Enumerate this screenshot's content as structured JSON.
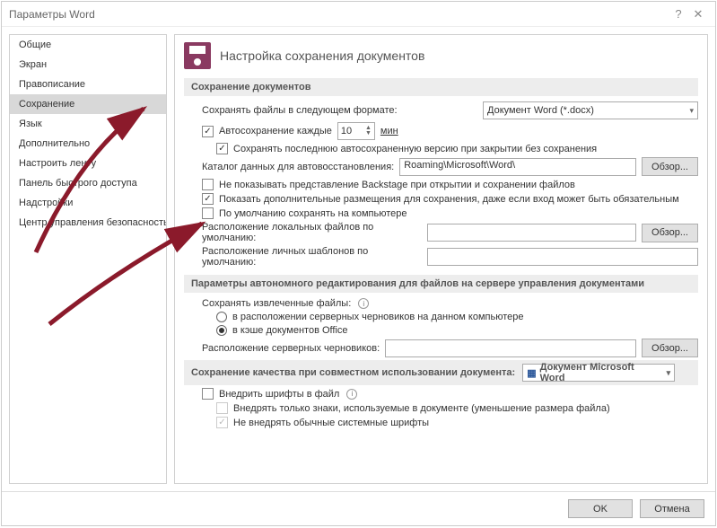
{
  "titlebar": {
    "title": "Параметры Word"
  },
  "sidebar": {
    "items": [
      {
        "label": "Общие"
      },
      {
        "label": "Экран"
      },
      {
        "label": "Правописание"
      },
      {
        "label": "Сохранение",
        "active": true
      },
      {
        "label": "Язык"
      },
      {
        "label": "Дополнительно"
      },
      {
        "label": "Настроить ленту"
      },
      {
        "label": "Панель быстрого доступа"
      },
      {
        "label": "Надстройки"
      },
      {
        "label": "Центр управления безопасностью"
      }
    ]
  },
  "content": {
    "header": "Настройка сохранения документов",
    "section1": {
      "title": "Сохранение документов",
      "save_format_label": "Сохранять файлы в следующем формате:",
      "save_format_value": "Документ Word (*.docx)",
      "autosave_label": "Автосохранение каждые",
      "autosave_value": "10",
      "autosave_unit": "мин",
      "keep_last_autosave": "Сохранять последнюю автосохраненную версию при закрытии без сохранения",
      "autorecover_path_label": "Каталог данных для автовосстановления:",
      "autorecover_path_value": "Roaming\\Microsoft\\Word\\",
      "browse": "Обзор...",
      "no_backstage": "Не показывать представление Backstage при открытии и сохранении файлов",
      "show_additional": "Показать дополнительные размещения для сохранения, даже если вход может быть обязательным",
      "save_to_computer": "По умолчанию сохранять на компьютере",
      "local_files_label": "Расположение локальных файлов по умолчанию:",
      "local_files_value": "",
      "templates_label": "Расположение личных шаблонов по умолчанию:",
      "templates_value": ""
    },
    "section2": {
      "title": "Параметры автономного редактирования для файлов на сервере управления документами",
      "save_extracted_label": "Сохранять извлеченные файлы:",
      "opt_server": "в расположении серверных черновиков на данном компьютере",
      "opt_cache": "в кэше документов Office",
      "drafts_path_label": "Расположение серверных черновиков:",
      "drafts_path_value": ""
    },
    "section3": {
      "title": "Сохранение качества при совместном использовании документа:",
      "doc_selector": "Документ Microsoft Word",
      "embed_fonts": "Внедрить шрифты в файл",
      "embed_used_only": "Внедрять только знаки, используемые в документе (уменьшение размера файла)",
      "no_system_fonts": "Не внедрять обычные системные шрифты"
    }
  },
  "footer": {
    "ok": "OK",
    "cancel": "Отмена"
  }
}
